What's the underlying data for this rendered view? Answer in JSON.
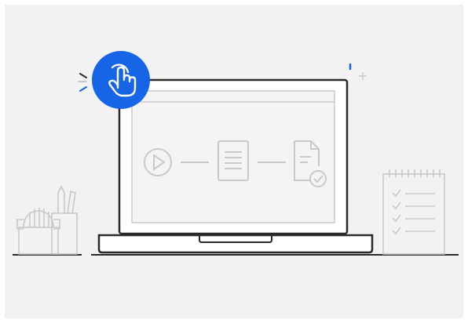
{
  "colors": {
    "background": "#f2f2f2",
    "stroke": "#2b2b2b",
    "muted": "#c9c9c9",
    "accent": "#1565e6",
    "accent_icon": "#ffffff"
  },
  "icons": {
    "touch": "pointing-hand-icon",
    "play": "play-icon",
    "document": "document-icon",
    "document_check": "document-check-icon",
    "checklist": "checklist-icon",
    "cactus": "cactus-icon",
    "pencil_cup": "pencil-cup-icon",
    "sparkle": "sparkle-icon"
  }
}
